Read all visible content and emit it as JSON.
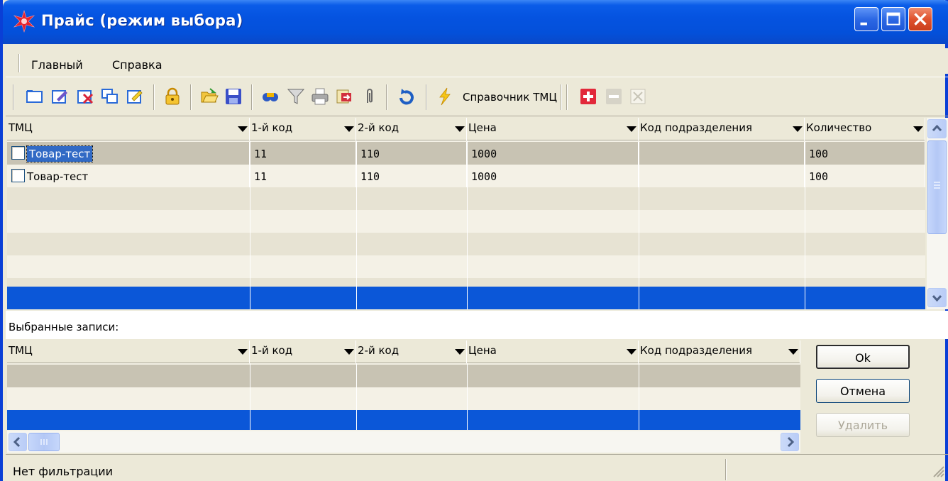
{
  "window": {
    "title": "Прайс (режим выбора)"
  },
  "menu": {
    "items": [
      "Главный",
      "Справка"
    ]
  },
  "toolbar": {
    "reference_label": "Справочник ТМЦ"
  },
  "main_grid": {
    "columns": [
      "ТМЦ",
      "1-й код",
      "2-й код",
      "Цена",
      "Код подразделения",
      "Количество"
    ],
    "rows": [
      {
        "name": "Товар-тест",
        "code1": "11",
        "code2": "110",
        "price": "1000",
        "dept": "",
        "qty": "100"
      },
      {
        "name": "Товар-тест",
        "code1": "11",
        "code2": "110",
        "price": "1000",
        "dept": "",
        "qty": "100"
      }
    ]
  },
  "selected": {
    "label": "Выбранные записи:",
    "columns": [
      "ТМЦ",
      "1-й код",
      "2-й код",
      "Цена",
      "Код подразделения"
    ]
  },
  "buttons": {
    "ok": "Ok",
    "cancel": "Отмена",
    "delete": "Удалить"
  },
  "status": {
    "text": "Нет фильтрации"
  },
  "colors": {
    "title_bar": "#0553e0",
    "selection": "#0b57d8",
    "row_alt": "#e7e3d3",
    "row_selected_inactive": "#c8c3b3"
  }
}
